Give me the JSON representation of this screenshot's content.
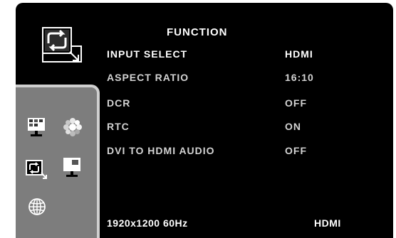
{
  "menu": {
    "title": "FUNCTION",
    "items": [
      {
        "label": "INPUT SELECT",
        "value": "HDMI"
      },
      {
        "label": "ASPECT RATIO",
        "value": "16:10"
      },
      {
        "label": "DCR",
        "value": "OFF"
      },
      {
        "label": "RTC",
        "value": "ON"
      },
      {
        "label": "DVI TO HDMI AUDIO",
        "value": "OFF"
      }
    ]
  },
  "status": {
    "resolution": "1920x1200 60Hz",
    "source": "HDMI"
  },
  "sidebar": {
    "items": [
      {
        "icon": "picture-icon"
      },
      {
        "icon": "color-settings-icon"
      },
      {
        "icon": "function-icon",
        "selected": true
      },
      {
        "icon": "pip-icon"
      },
      {
        "icon": "language-globe-icon"
      }
    ]
  },
  "colors": {
    "background": "#000000",
    "sidebar": "#7d7d7d",
    "sidebar_border": "#cfcfcf",
    "text": "#ffffff"
  }
}
